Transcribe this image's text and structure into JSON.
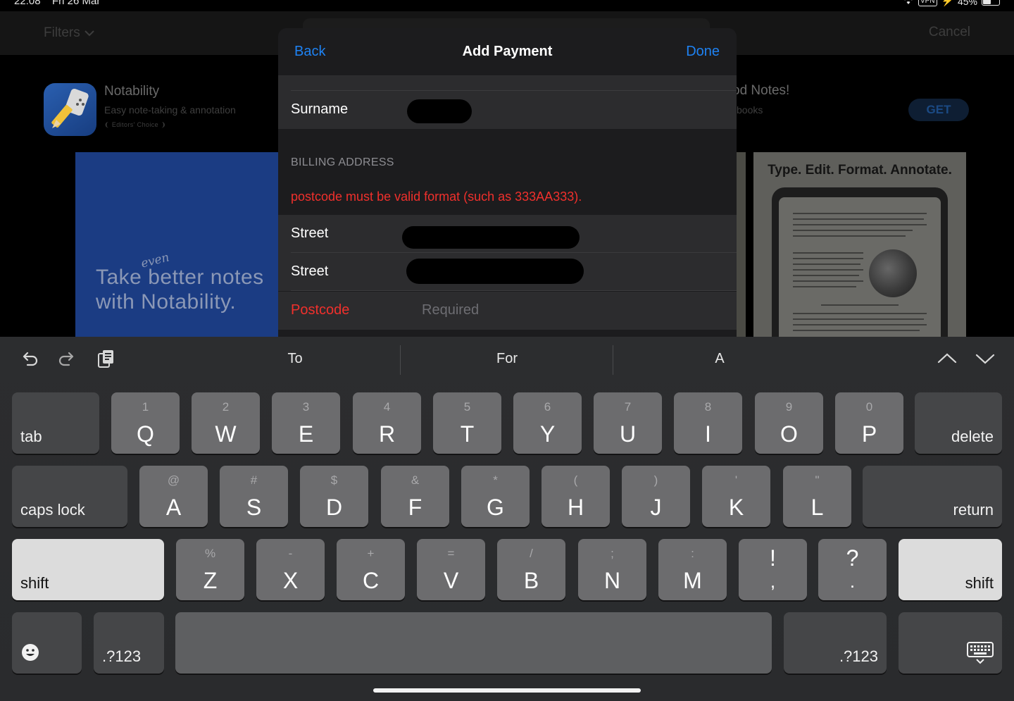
{
  "status_bar": {
    "time": "22:08",
    "date": "Fri 26 Mar",
    "vpn": "VPN",
    "battery": "45%"
  },
  "background": {
    "filters_label": "Filters",
    "cancel_label": "Cancel",
    "app": {
      "name": "Notability",
      "subtitle": "Easy note-taking & annotation",
      "badge": "Editors' Choice"
    },
    "app_right": {
      "name": "od Notes!",
      "subtitle": "books",
      "get_label": "GET"
    },
    "screenshot_left_text": "Take better notes with Notability.",
    "screenshot_left_handwritten": "even",
    "screenshot_right_title": "Type. Edit. Format. Annotate."
  },
  "modal": {
    "back_label": "Back",
    "title": "Add Payment",
    "done_label": "Done",
    "surname_label": "Surname",
    "billing_header": "BILLING ADDRESS",
    "error_text": "postcode must be valid format (such as 333AA333).",
    "street1_label": "Street",
    "street2_label": "Street",
    "postcode_label": "Postcode",
    "postcode_placeholder": "Required"
  },
  "keyboard": {
    "suggestions": [
      "To",
      "For",
      "A"
    ],
    "row1": [
      {
        "main": "Q",
        "sub": "1"
      },
      {
        "main": "W",
        "sub": "2"
      },
      {
        "main": "E",
        "sub": "3"
      },
      {
        "main": "R",
        "sub": "4"
      },
      {
        "main": "T",
        "sub": "5"
      },
      {
        "main": "Y",
        "sub": "6"
      },
      {
        "main": "U",
        "sub": "7"
      },
      {
        "main": "I",
        "sub": "8"
      },
      {
        "main": "O",
        "sub": "9"
      },
      {
        "main": "P",
        "sub": "0"
      }
    ],
    "row2": [
      {
        "main": "A",
        "sub": "@"
      },
      {
        "main": "S",
        "sub": "#"
      },
      {
        "main": "D",
        "sub": "$"
      },
      {
        "main": "F",
        "sub": "&"
      },
      {
        "main": "G",
        "sub": "*"
      },
      {
        "main": "H",
        "sub": "("
      },
      {
        "main": "J",
        "sub": ")"
      },
      {
        "main": "K",
        "sub": "'"
      },
      {
        "main": "L",
        "sub": "\""
      }
    ],
    "row3": [
      {
        "main": "Z",
        "sub": "%"
      },
      {
        "main": "X",
        "sub": "-"
      },
      {
        "main": "C",
        "sub": "+"
      },
      {
        "main": "V",
        "sub": "="
      },
      {
        "main": "B",
        "sub": "/"
      },
      {
        "main": "N",
        "sub": ";"
      },
      {
        "main": "M",
        "sub": ":"
      }
    ],
    "punct1": {
      "top": "!",
      "bottom": ","
    },
    "punct2": {
      "top": "?",
      "bottom": "."
    },
    "tab_label": "tab",
    "delete_label": "delete",
    "caps_label": "caps lock",
    "return_label": "return",
    "shift_label": "shift",
    "numbers_label": ".?123",
    "emoji_icon": "emoji-icon",
    "hide_keyboard_icon": "keyboard-dismiss-icon"
  }
}
